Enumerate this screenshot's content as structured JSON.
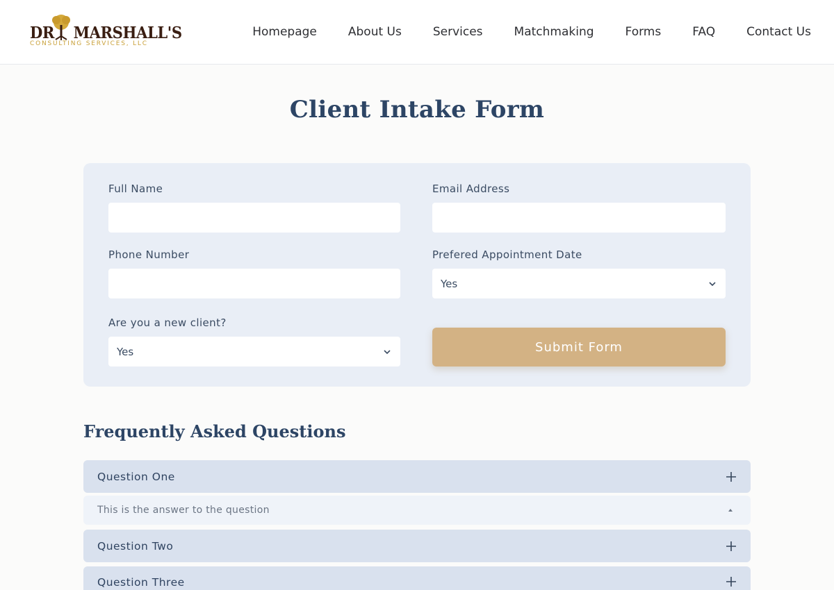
{
  "header": {
    "logo_main_left": "DR",
    "logo_main_right": "MARSHALL'S",
    "logo_sub": "CONSULTING SERVICES, LLC",
    "nav": [
      "Homepage",
      "About Us",
      "Services",
      "Matchmaking",
      "Forms",
      "FAQ",
      "Contact Us"
    ]
  },
  "page_title": "Client Intake Form",
  "form": {
    "full_name_label": "Full Name",
    "full_name_value": "",
    "email_label": "Email Address",
    "email_value": "",
    "phone_label": "Phone Number",
    "phone_value": "",
    "appt_label": "Prefered Appointment Date",
    "appt_value": "Yes",
    "new_client_label": "Are you a new client?",
    "new_client_value": "Yes",
    "submit_label": "Submit Form"
  },
  "faq": {
    "title": "Frequently Asked Questions",
    "items": [
      {
        "question": "Question One",
        "answer": "This is the answer to the question"
      },
      {
        "question": "Question Two"
      },
      {
        "question": "Question Three"
      }
    ]
  },
  "colors": {
    "accent_gold": "#d3b284",
    "heading_navy": "#2d4565",
    "card_bg": "#e9eef6",
    "faq_bg": "#d9e1ee"
  }
}
